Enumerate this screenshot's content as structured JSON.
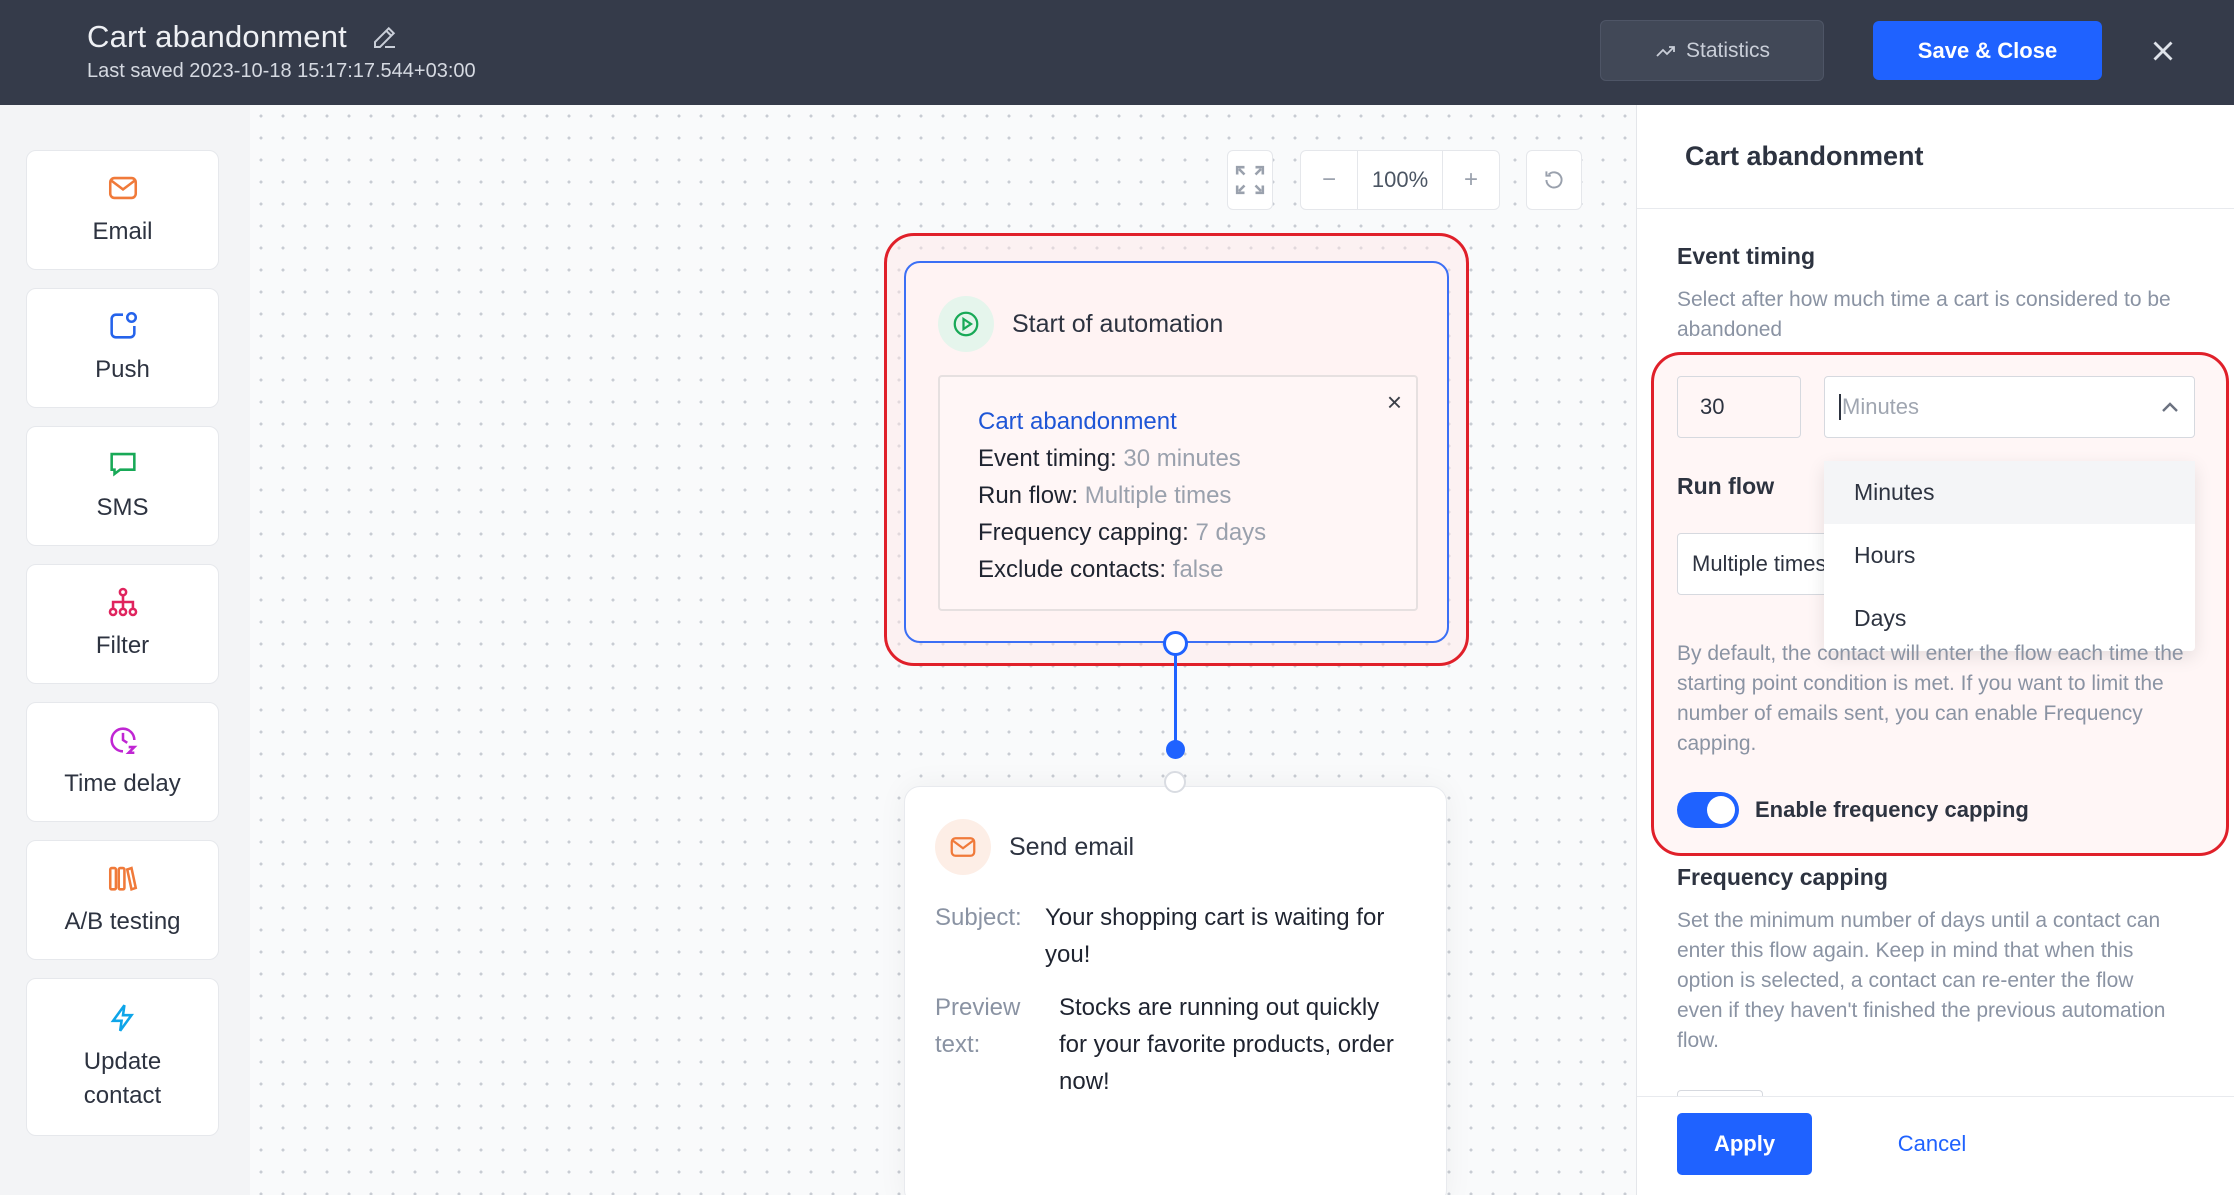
{
  "header": {
    "title": "Cart abandonment",
    "last_saved": "Last saved 2023-10-18 15:17:17.544+03:00",
    "statistics_label": "Statistics",
    "save_close_label": "Save & Close",
    "icons": [
      "edit-pencil-icon",
      "trend-up-icon",
      "close-icon"
    ]
  },
  "palette": {
    "items": [
      {
        "label": "Email",
        "icon": "mail-icon",
        "color": "#f07a3a"
      },
      {
        "label": "Push",
        "icon": "push-icon",
        "color": "#2563eb"
      },
      {
        "label": "SMS",
        "icon": "chat-bubble-icon",
        "color": "#18a957"
      },
      {
        "label": "Filter",
        "icon": "tree-filter-icon",
        "color": "#e0245e"
      },
      {
        "label": "Time delay",
        "icon": "clock-icon",
        "color": "#c026d3"
      },
      {
        "label": "A/B testing",
        "icon": "ab-books-icon",
        "color": "#f07a3a"
      },
      {
        "label": "Update contact",
        "icon": "bolt-icon",
        "color": "#0ea5e9"
      }
    ]
  },
  "canvas": {
    "zoom": "100%",
    "zoom_out": "−",
    "zoom_in": "+",
    "start_node": {
      "title": "Start of automation",
      "trigger": "Cart abandonment",
      "lines": [
        {
          "key": "Event timing:",
          "value": "30 minutes"
        },
        {
          "key": "Run flow:",
          "value": "Multiple times"
        },
        {
          "key": "Frequency capping:",
          "value": "7 days"
        },
        {
          "key": "Exclude contacts:",
          "value": "false"
        }
      ],
      "close": "×"
    },
    "email_node": {
      "title": "Send email",
      "subject_label": "Subject:",
      "subject_line1": "Your shopping cart is waiting for",
      "subject_line2": "you!",
      "preview_label1": "Preview",
      "preview_label2": "text:",
      "preview_line1": "Stocks are running out quickly",
      "preview_line2": "for your favorite products, order",
      "preview_line3": "now!"
    }
  },
  "panel": {
    "title": "Cart abandonment",
    "event_timing": {
      "heading": "Event timing",
      "desc_line1": "Select after how much time a cart is considered to be",
      "desc_line2": "abandoned",
      "amount": "30",
      "unit_placeholder": "Minutes",
      "options": [
        "Minutes",
        "Hours",
        "Days"
      ],
      "highlighted_option": "Minutes"
    },
    "run_flow": {
      "heading": "Run flow",
      "value": "Multiple times",
      "desc": [
        "By default, the contact will enter the flow each time the",
        "starting point condition is met. If you want to limit the",
        "number of emails sent, you can enable Frequency",
        "capping."
      ]
    },
    "toggle": {
      "label": "Enable frequency capping",
      "on": true
    },
    "frequency_capping": {
      "heading": "Frequency capping",
      "desc": [
        "Set the minimum number of days until a contact can",
        "enter this flow again. Keep in mind that when this",
        "option is selected, a contact can re-enter the flow",
        "even if they haven't finished the previous automation",
        "flow."
      ]
    },
    "apply_label": "Apply",
    "cancel_label": "Cancel"
  },
  "colors": {
    "accent": "#1f62ff",
    "header_bg": "#353b4a",
    "highlight": "#e0202a"
  }
}
